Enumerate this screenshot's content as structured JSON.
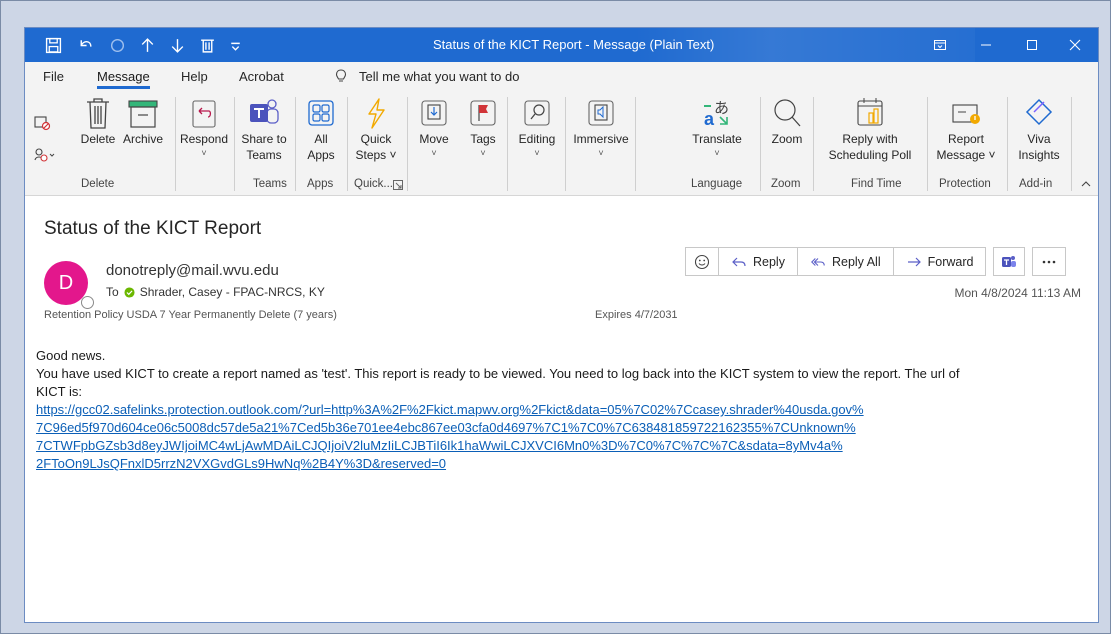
{
  "window": {
    "title": "Status of the KICT Report  -  Message (Plain Text)",
    "accent_color": "#1f6ad0"
  },
  "quick_access": {
    "icons": [
      "save-icon",
      "undo-icon",
      "redo-icon",
      "up-icon",
      "down-icon",
      "delete-icon",
      "customize-icon"
    ]
  },
  "menu": {
    "tabs": [
      "File",
      "Message",
      "Help",
      "Acrobat"
    ],
    "active_tab": "Message",
    "tell_me": "Tell me what you want to do"
  },
  "ribbon": {
    "delete_label": "Delete",
    "archive_label": "Archive",
    "respond_label": "Respond",
    "share_teams_1": "Share to",
    "share_teams_2": "Teams",
    "all_apps_1": "All",
    "all_apps_2": "Apps",
    "quick_steps_1": "Quick",
    "quick_steps_2": "Steps ˅",
    "move_label": "Move",
    "tags_label": "Tags",
    "editing_label": "Editing",
    "immersive_label": "Immersive",
    "translate_label": "Translate",
    "zoom_label": "Zoom",
    "reply_poll_1": "Reply with",
    "reply_poll_2": "Scheduling Poll",
    "report_1": "Report",
    "report_2": "Message ˅",
    "viva_1": "Viva",
    "viva_2": "Insights",
    "groups": {
      "delete": "Delete",
      "teams": "Teams",
      "apps": "Apps",
      "quick": "Quick...",
      "language": "Language",
      "zoom": "Zoom",
      "find_time": "Find Time",
      "protection": "Protection",
      "addin": "Add-in"
    }
  },
  "message": {
    "subject": "Status of the KICT Report",
    "avatar_initial": "D",
    "avatar_color": "#e3178c",
    "sender": "donotreply@mail.wvu.edu",
    "to_label": "To",
    "recipient": "Shrader, Casey - FPAC-NRCS, KY",
    "retention": "Retention Policy  USDA 7 Year Permanently Delete (7 years)",
    "expires": "Expires  4/7/2031",
    "datetime": "Mon 4/8/2024 11:13 AM",
    "actions": {
      "reply": "Reply",
      "reply_all": "Reply All",
      "forward": "Forward"
    },
    "body": {
      "line1": "Good news.",
      "line2": "You have used KICT to create a report named as 'test'. This report is ready to be viewed. You need to log back into the KICT system to view the report. The url of",
      "line3": "KICT is:",
      "link1": "https://gcc02.safelinks.protection.outlook.com/?url=http%3A%2F%2Fkict.mapwv.org%2Fkict&data=05%7C02%7Ccasey.shrader%40usda.gov%",
      "link2": "7C96ed5f970d604ce06c5008dc57de5a21%7Ced5b36e701ee4ebc867ee03cfa0d4697%7C1%7C0%7C638481859722162355%7CUnknown%",
      "link3": "7CTWFpbGZsb3d8eyJWIjoiMC4wLjAwMDAiLCJQIjoiV2luMzIiLCJBTiI6Ik1haWwiLCJXVCI6Mn0%3D%7C0%7C%7C%7C&sdata=8yMv4a%",
      "link4": "2FToOn9LJsQFnxlD5rrzN2VXGvdGLs9HwNq%2B4Y%3D&reserved=0"
    }
  }
}
